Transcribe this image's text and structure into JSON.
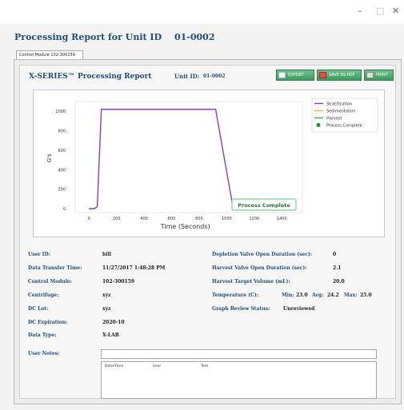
{
  "window": {
    "minimize": "–",
    "maximize": "□",
    "close": "✕"
  },
  "report_header": {
    "title": "Processing Report for Unit ID",
    "unit_id": "01-0002"
  },
  "tab": {
    "label": "Control Module 102-300159"
  },
  "processing": {
    "title": "X-SERIES™ Processing Report",
    "unit_label": "Unit ID:",
    "unit_value": "01-0002",
    "buttons": {
      "export": "EXPORT",
      "save_pdf": "SAVE AS PDF",
      "print": "PRINT"
    }
  },
  "chart_data": {
    "type": "line",
    "xlabel": "Time (Seconds)",
    "ylabel": "G's",
    "xlim": [
      -100,
      1550
    ],
    "ylim": [
      -40,
      1100
    ],
    "x_ticks": [
      0,
      200,
      400,
      600,
      800,
      1000,
      1200,
      1400
    ],
    "y_ticks": [
      0,
      200,
      400,
      600,
      800,
      1000
    ],
    "series": [
      {
        "name": "Stratification",
        "color": "#8b3fae",
        "x": [
          0,
          40,
          60,
          90,
          920,
          1040
        ],
        "y": [
          0,
          0,
          20,
          1020,
          1020,
          60
        ]
      },
      {
        "name": "Sedimentation",
        "color": "#f2b233",
        "x": [],
        "y": []
      },
      {
        "name": "Harvest",
        "color": "#33b14a",
        "x": [
          1040,
          1320
        ],
        "y": [
          60,
          60
        ]
      }
    ],
    "process_complete": {
      "name": "Process Complete",
      "x": 1340,
      "y": 0,
      "color": "#1a8a2a"
    },
    "annotation": "Process Complete",
    "legend_position": "top-right"
  },
  "details": {
    "left": [
      {
        "label": "User ID:",
        "value": "bill"
      },
      {
        "label": "Data Transfer Time:",
        "value": "11/27/2017 1:48:28 PM"
      },
      {
        "label": "Control Module:",
        "value": "102-300159"
      },
      {
        "label": "Centrifuge:",
        "value": "xyz"
      },
      {
        "label": "DC Lot:",
        "value": "xyz"
      },
      {
        "label": "DC Expiration:",
        "value": "2020-10"
      },
      {
        "label": "Data Type:",
        "value": "X-LAB"
      }
    ],
    "right": {
      "depletion_label": "Depletion Valve Open Duration (sec):",
      "depletion_value": "0",
      "harvest_label": "Harvest Valve Open Duration (sec):",
      "harvest_value": "2.1",
      "volume_label": "Harvest Target Volume (mL):",
      "volume_value": "20.0",
      "temp_label": "Temperature (C):",
      "temp_min_label": "Min:",
      "temp_min": "23.0",
      "temp_avg_label": "Avg:",
      "temp_avg": "24.2",
      "temp_max_label": "Max:",
      "temp_max": "25.0",
      "graph_label": "Graph Review Status:",
      "graph_value": "Unreviewed"
    }
  },
  "notes": {
    "label": "User Notes:",
    "columns": [
      "Date/Time",
      "User",
      "Text"
    ]
  }
}
